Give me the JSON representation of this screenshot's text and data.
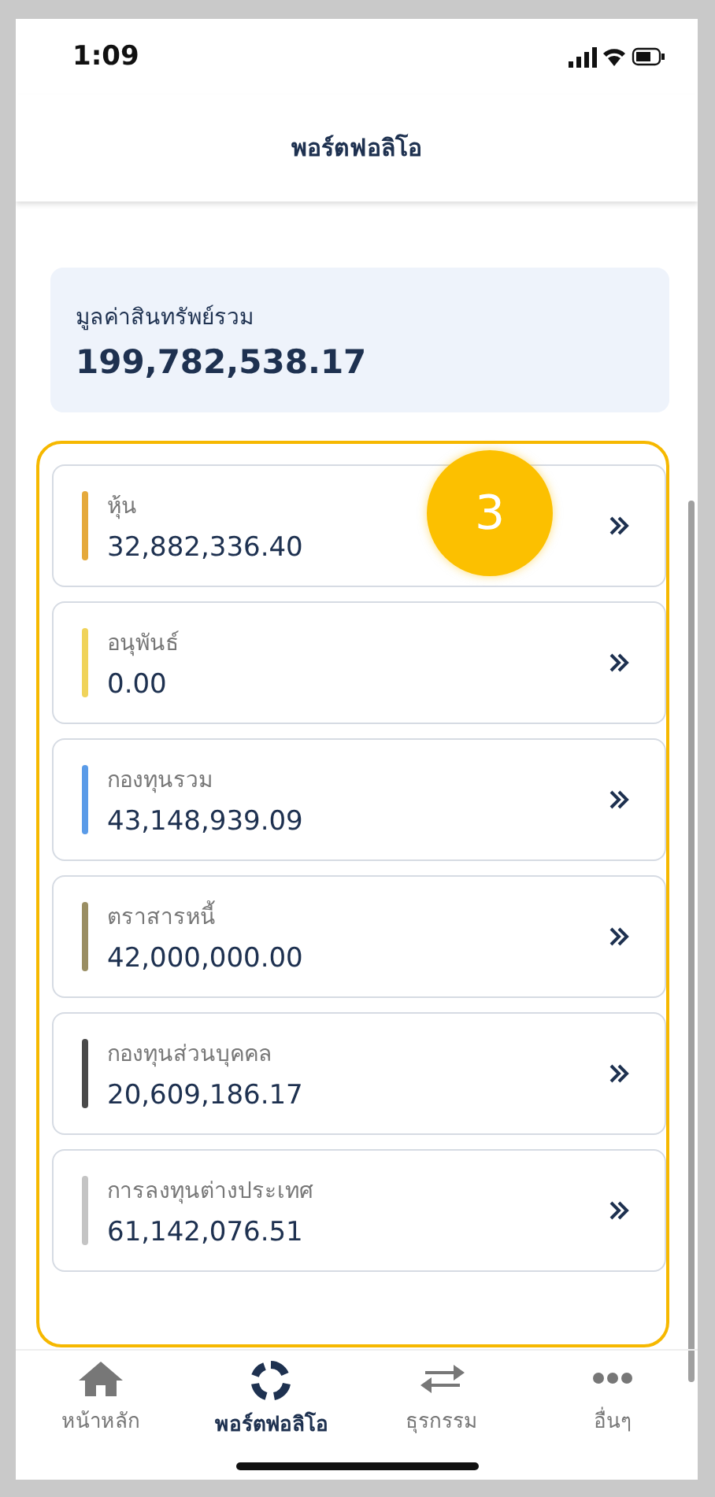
{
  "status_bar": {
    "time": "1:09"
  },
  "header": {
    "title": "พอร์ตฟอลิโอ"
  },
  "summary": {
    "label": "มูลค่าสินทรัพย์รวม",
    "value": "199,782,538.17"
  },
  "annotation": {
    "label": "3"
  },
  "holdings": [
    {
      "label": "หุ้น",
      "value": "32,882,336.40",
      "color": "#e5a93b"
    },
    {
      "label": "อนุพันธ์",
      "value": "0.00",
      "color": "#f0d35a"
    },
    {
      "label": "กองทุนรวม",
      "value": "43,148,939.09",
      "color": "#5a9be8"
    },
    {
      "label": "ตราสารหนี้",
      "value": "42,000,000.00",
      "color": "#9a8e63"
    },
    {
      "label": "กองทุนส่วนบุคคล",
      "value": "20,609,186.17",
      "color": "#4a4a4a"
    },
    {
      "label": "การลงทุนต่างประเทศ",
      "value": "61,142,076.51",
      "color": "#c4c4c4"
    }
  ],
  "nav": [
    {
      "kind": "home",
      "label": "หน้าหลัก",
      "selected": false
    },
    {
      "kind": "portfolio",
      "label": "พอร์ตฟอลิโอ",
      "selected": true
    },
    {
      "kind": "transfer",
      "label": "ธุรกรรม",
      "selected": false
    },
    {
      "kind": "more",
      "label": "อื่นๆ",
      "selected": false
    }
  ]
}
